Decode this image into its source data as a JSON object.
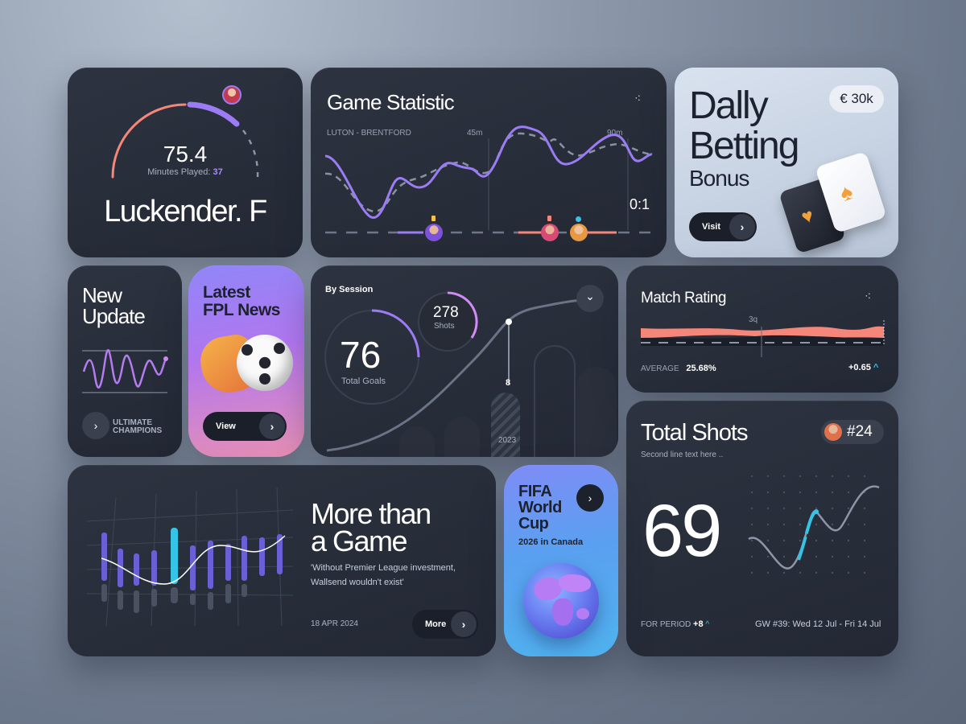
{
  "player_card": {
    "value": "75.4",
    "minutes_label": "Minutes Played:",
    "minutes_value": "37",
    "name": "Luckender. F"
  },
  "game_statistic": {
    "title": "Game Statistic",
    "match": "LUTON - BRENTFORD",
    "marker_45": "45m",
    "marker_90": "90m",
    "score": "0:1"
  },
  "betting": {
    "title_line1": "Dally",
    "title_line2": "Betting",
    "title_line3": "Bonus",
    "amount": "€ 30k",
    "visit_label": "Visit"
  },
  "new_update": {
    "title_line1": "New",
    "title_line2": "Update",
    "brand_line1": "ULTIMATE",
    "brand_line2": "CHAMPIONS"
  },
  "fpl": {
    "title_line1": "Latest",
    "title_line2": "FPL News",
    "view_label": "View"
  },
  "session": {
    "title": "By Session",
    "goals_value": "76",
    "goals_label": "Total Goals",
    "shots_value": "278",
    "shots_label": "Shots",
    "bar_value": "8",
    "year": "2023"
  },
  "match_rating": {
    "title": "Match Rating",
    "marker": "3q",
    "average_label": "AVERAGE",
    "average_value": "25.68%",
    "delta": "+0.65"
  },
  "total_shots": {
    "title": "Total Shots",
    "subtitle": "Second line text here ..",
    "badge": "#24",
    "value": "69",
    "period_label": "FOR PERIOD",
    "period_value": "+8",
    "gameweek": "GW #39: Wed 12 Jul - Fri 14 Jul"
  },
  "more_game": {
    "title_line1": "More than",
    "title_line2": "a Game",
    "quote_line1": "'Without Premier League investment,",
    "quote_line2": "Wallsend wouldn't exist'",
    "date": "18 APR 2024",
    "more_label": "More"
  },
  "world_cup": {
    "title_line1": "FIFA",
    "title_line2": "World",
    "title_line3": "Cup",
    "subtitle": "2026 in Canada"
  },
  "colors": {
    "accent": "#9b7cf4",
    "salmon": "#f5877a",
    "cyan": "#35c3e6",
    "dark": "#232834"
  },
  "icons": {
    "arrow": "›",
    "chevron": "⌄",
    "dots": "⁖"
  }
}
